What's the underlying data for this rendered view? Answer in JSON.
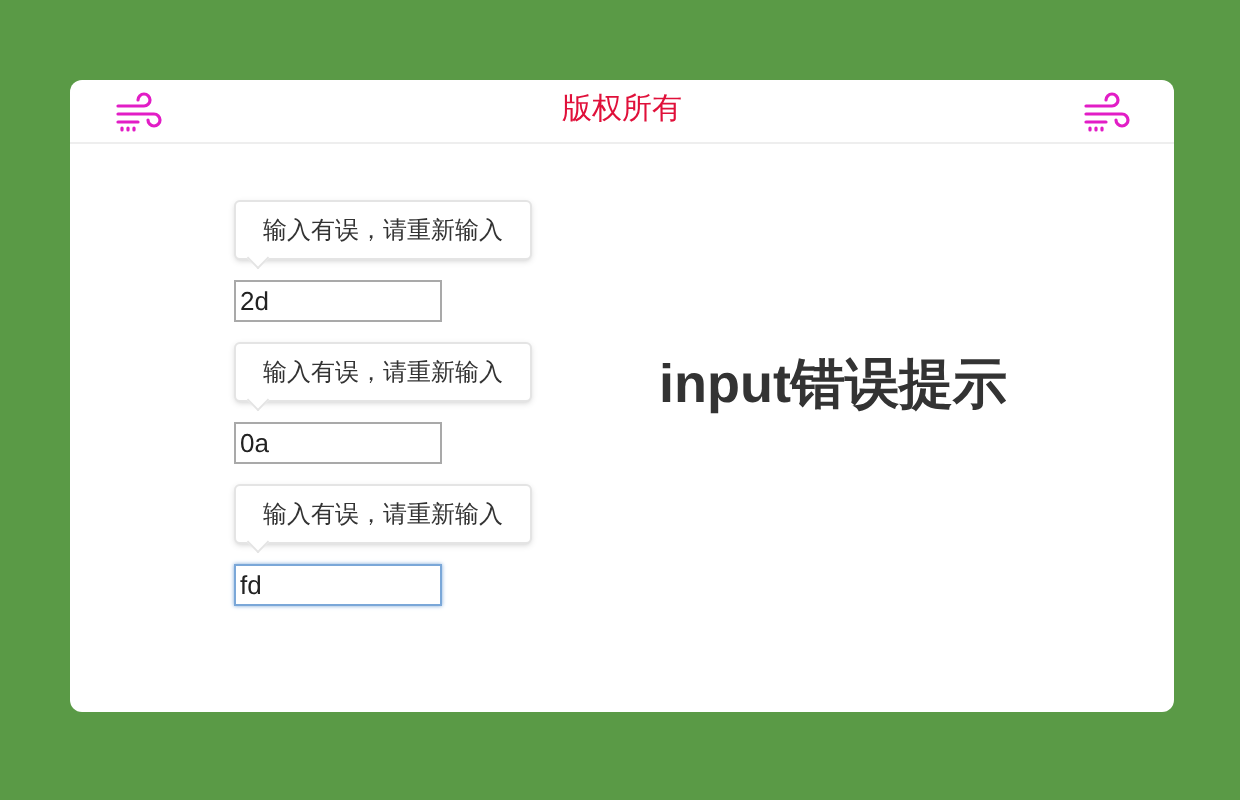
{
  "header": {
    "title": "版权所有"
  },
  "fields": [
    {
      "tooltip": "输入有误，请重新输入",
      "value": "2d",
      "focused": false
    },
    {
      "tooltip": "输入有误，请重新输入",
      "value": "0a",
      "focused": false
    },
    {
      "tooltip": "输入有误，请重新输入",
      "value": "fd",
      "focused": true
    }
  ],
  "heading": "input错误提示"
}
